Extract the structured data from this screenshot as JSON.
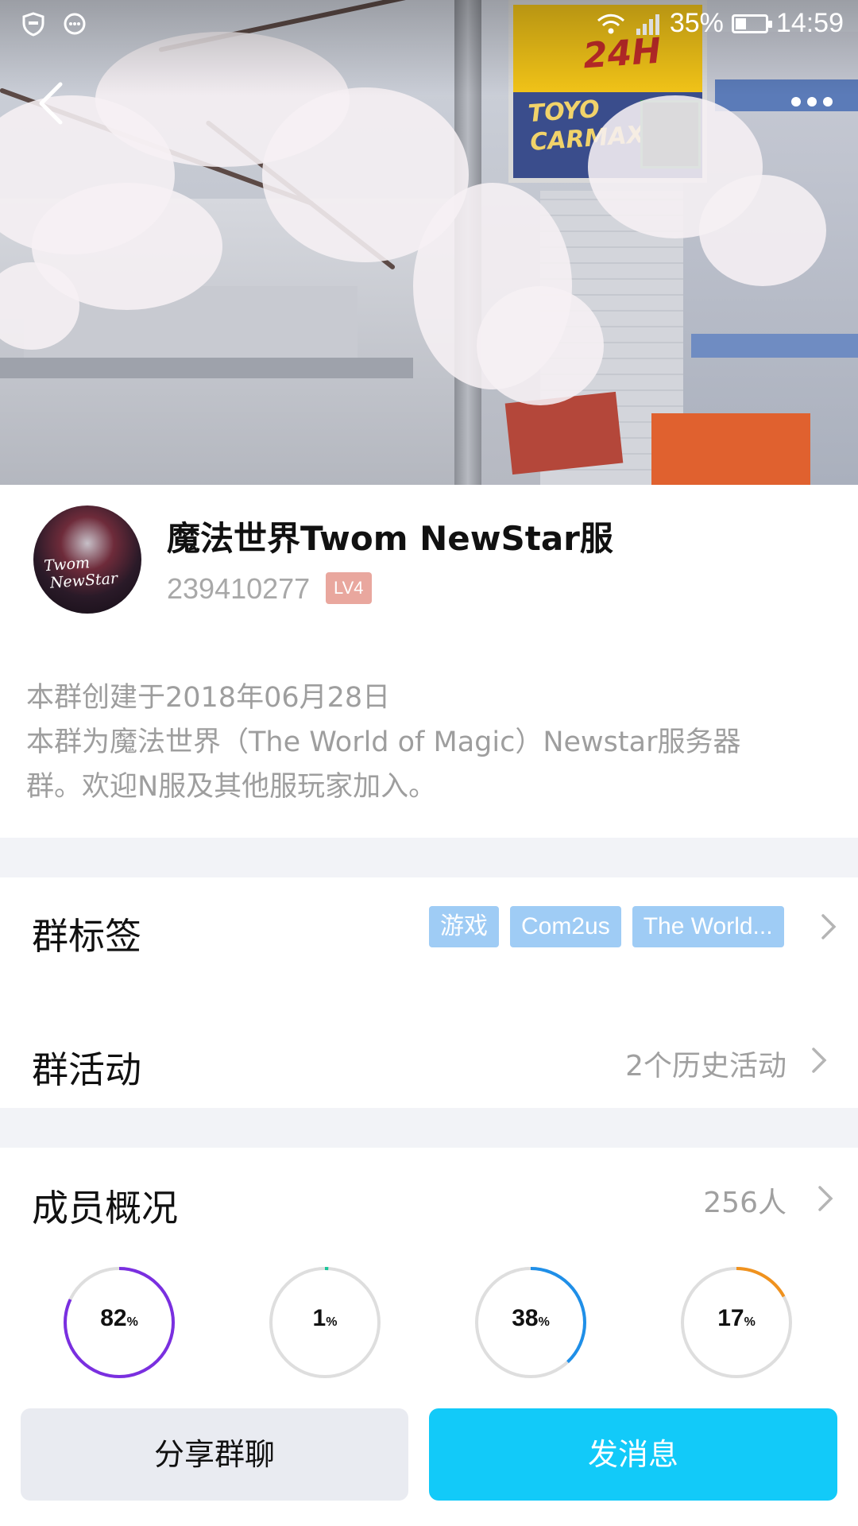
{
  "status_bar": {
    "battery": "35%",
    "time": "14:59",
    "battery_level": 0.35
  },
  "group": {
    "name": "魔法世界Twom NewStar服",
    "id": "239410277",
    "level": "LV4",
    "avatar_text_line1": "Twom",
    "avatar_text_line2": "NewStar"
  },
  "description": {
    "line1": "本群创建于2018年06月28日",
    "line2": "本群为魔法世界（The World of Magic）Newstar服务器",
    "line3": "群。欢迎N服及其他服玩家加入。"
  },
  "tags_row": {
    "label": "群标签",
    "tags": [
      "游戏",
      "Com2us",
      "The World..."
    ]
  },
  "activity_row": {
    "label": "群活动",
    "value": "2个历史活动"
  },
  "members_row": {
    "label": "成员概况",
    "value": "256人"
  },
  "stats": [
    {
      "value": "82",
      "unit": "%",
      "percent": 82,
      "color": "#7a2fe0"
    },
    {
      "value": "1",
      "unit": "%",
      "percent": 1,
      "color": "#19c59a"
    },
    {
      "value": "38",
      "unit": "%",
      "percent": 38,
      "color": "#1f8fe8"
    },
    {
      "value": "17",
      "unit": "%",
      "percent": 17,
      "color": "#f0921e"
    }
  ],
  "buttons": {
    "share": "分享群聊",
    "send": "发消息"
  },
  "colors": {
    "accent": "#12caf9",
    "tag": "#9fccf5",
    "level": "#e9a79e"
  }
}
